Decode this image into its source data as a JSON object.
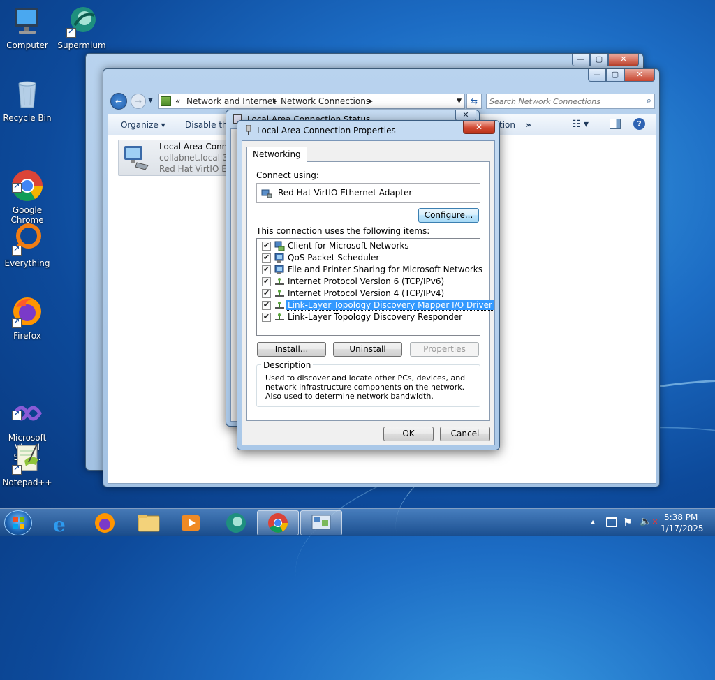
{
  "desktop": {
    "icons": [
      {
        "label": "Computer"
      },
      {
        "label": "Supermium"
      },
      {
        "label": "Recycle Bin"
      },
      {
        "label": "Google\nChrome"
      },
      {
        "label": "Everything"
      },
      {
        "label": "Firefox"
      },
      {
        "label": "Microsoft\nVisual Stud..."
      },
      {
        "label": "Notepad++"
      }
    ]
  },
  "explorer": {
    "breadcrumb": {
      "root": "«",
      "seg1": "Network and Internet",
      "sep": "▶",
      "seg2": "Network Connections"
    },
    "search_placeholder": "Search Network Connections",
    "toolbar": {
      "organize": "Organize",
      "disable": "Disable this",
      "diagnose_tail": "tion",
      "more": "»"
    },
    "connection": {
      "name": "Local Area Connec",
      "network": "collabnet.local  3",
      "adapter": "Red Hat VirtIO Ethe"
    }
  },
  "status_window": {
    "title": "Local Area Connection Status"
  },
  "dialog": {
    "title": "Local Area Connection Properties",
    "tab": "Networking",
    "connect_using_label": "Connect using:",
    "adapter_name": "Red Hat VirtIO Ethernet Adapter",
    "configure_button": "Configure...",
    "items_label": "This connection uses the following items:",
    "items": [
      {
        "label": "Client for Microsoft Networks",
        "checked": "✔",
        "icon": "network-client-icon"
      },
      {
        "label": "QoS Packet Scheduler",
        "checked": "✔",
        "icon": "network-service-icon"
      },
      {
        "label": "File and Printer Sharing for Microsoft Networks",
        "checked": "✔",
        "icon": "network-service-icon"
      },
      {
        "label": "Internet Protocol Version 6 (TCP/IPv6)",
        "checked": "✔",
        "icon": "protocol-icon"
      },
      {
        "label": "Internet Protocol Version 4 (TCP/IPv4)",
        "checked": "✔",
        "icon": "protocol-icon"
      },
      {
        "label": "Link-Layer Topology Discovery Mapper I/O Driver",
        "checked": "✔",
        "icon": "protocol-icon",
        "selected": true
      },
      {
        "label": "Link-Layer Topology Discovery Responder",
        "checked": "✔",
        "icon": "protocol-icon"
      }
    ],
    "install_button": "Install...",
    "uninstall_button": "Uninstall",
    "properties_button": "Properties",
    "description_label": "Description",
    "description_text": "Used to discover and locate other PCs, devices, and network infrastructure components on the network.  Also used to determine network bandwidth.",
    "ok_button": "OK",
    "cancel_button": "Cancel"
  },
  "taskbar": {
    "clock_time": "5:38 PM",
    "clock_date": "1/17/2025",
    "tray_expand": "▲"
  },
  "colors": {
    "selection": "#3399ff",
    "desktop": "#1c6cc4"
  }
}
